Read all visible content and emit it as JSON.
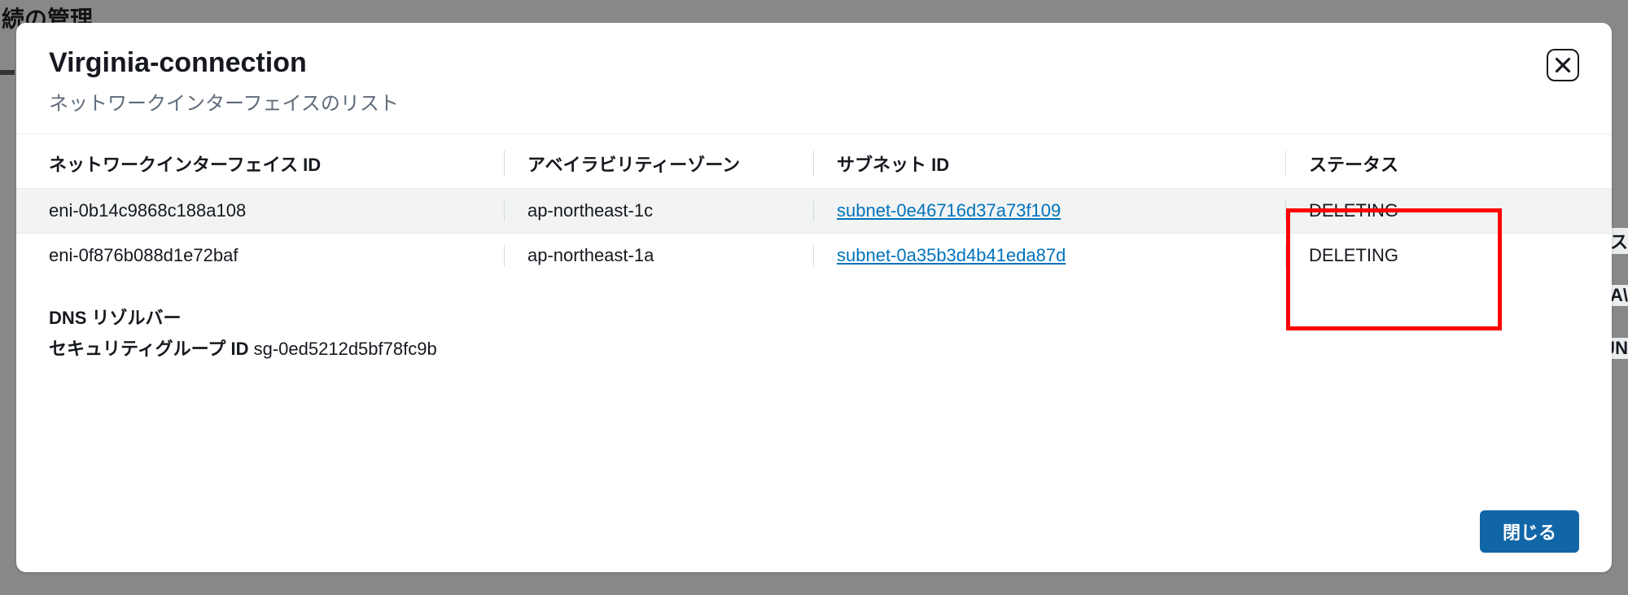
{
  "backdrop": {
    "title_fragment": "続の管理"
  },
  "modal": {
    "title": "Virginia-connection",
    "subtitle": "ネットワークインターフェイスのリスト",
    "close_button_label": "閉じる"
  },
  "table": {
    "headers": {
      "eni_id": "ネットワークインターフェイス ID",
      "az": "アベイラビリティーゾーン",
      "subnet": "サブネット ID",
      "status": "ステータス"
    },
    "rows": [
      {
        "eni_id": "eni-0b14c9868c188a108",
        "az": "ap-northeast-1c",
        "subnet": "subnet-0e46716d37a73f109",
        "status": "DELETING"
      },
      {
        "eni_id": "eni-0f876b088d1e72baf",
        "az": "ap-northeast-1a",
        "subnet": "subnet-0a35b3d4b41eda87d",
        "status": "DELETING"
      }
    ]
  },
  "footer_info": {
    "dns_resolver_label": "DNS リゾルバー",
    "sec_group_label": "セキュリティグループ ID",
    "sec_group_value": "sg-0ed5212d5bf78fc9b"
  },
  "right_edge": {
    "frag1": "ス",
    "frag2": "A\\",
    "frag3": "JN"
  }
}
